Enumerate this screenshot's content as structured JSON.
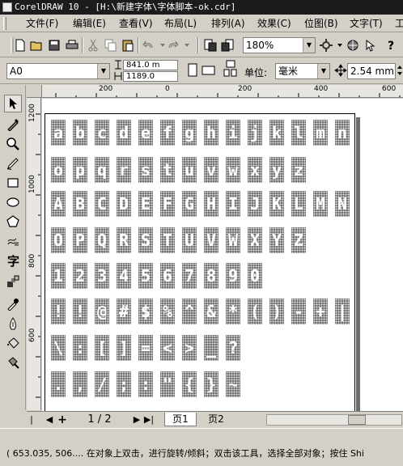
{
  "window": {
    "title": "CorelDRAW 10 - [H:\\新建字体\\字体脚本-ok.cdr]"
  },
  "menu": [
    {
      "label": "文件(F)"
    },
    {
      "label": "编辑(E)"
    },
    {
      "label": "查看(V)"
    },
    {
      "label": "布局(L)"
    },
    {
      "label": "排列(A)"
    },
    {
      "label": "效果(C)"
    },
    {
      "label": "位图(B)"
    },
    {
      "label": "文字(T)"
    },
    {
      "label": "工"
    }
  ],
  "toolbar": {
    "zoom_value": "180%",
    "paper_value": "A0",
    "width_value": "841.0 m",
    "height_value": "1189.0",
    "units_label": "单位:",
    "units_value": "毫米",
    "nudge_value": "2.54 mm"
  },
  "ruler": {
    "h_labels": [
      "200",
      "0",
      "200",
      "400",
      "600"
    ],
    "v_labels": [
      "1200",
      "1000",
      "800",
      "600"
    ]
  },
  "tools": [
    {
      "icon": "pick-tool-icon"
    },
    {
      "icon": "shape-tool-icon"
    },
    {
      "icon": "zoom-tool-icon"
    },
    {
      "icon": "freehand-tool-icon"
    },
    {
      "icon": "rectangle-tool-icon"
    },
    {
      "icon": "ellipse-tool-icon"
    },
    {
      "icon": "polygon-tool-icon"
    },
    {
      "icon": "spiral-tool-icon"
    },
    {
      "icon": "text-tool-icon"
    },
    {
      "icon": "interactive-tool-icon"
    },
    {
      "icon": "eyedropper-tool-icon"
    },
    {
      "icon": "outline-tool-icon"
    },
    {
      "icon": "fill-tool-icon"
    },
    {
      "icon": "interactive-fill-icon"
    }
  ],
  "glyph_rows": [
    [
      "a",
      "b",
      "c",
      "d",
      "e",
      "f",
      "g",
      "h",
      "i",
      "j",
      "k",
      "l",
      "m",
      "n"
    ],
    [
      "o",
      "p",
      "q",
      "r",
      "s",
      "t",
      "u",
      "v",
      "w",
      "x",
      "y",
      "z"
    ],
    [
      "A",
      "B",
      "C",
      "D",
      "E",
      "F",
      "G",
      "H",
      "I",
      "J",
      "K",
      "L",
      "M",
      "N"
    ],
    [
      "O",
      "P",
      "Q",
      "R",
      "S",
      "T",
      "U",
      "V",
      "W",
      "X",
      "Y",
      "Z"
    ],
    [
      "1",
      "2",
      "3",
      "4",
      "5",
      "6",
      "7",
      "8",
      "9",
      "0"
    ],
    [
      "!",
      "!",
      "@",
      "#",
      "$",
      "%",
      "^",
      "&",
      "*",
      "(",
      ")",
      "-",
      "+",
      "|"
    ],
    [
      "\\",
      ":",
      "[",
      "]",
      "=",
      "<",
      ">",
      "_",
      "?"
    ],
    [
      ".",
      ",",
      "/",
      ";",
      ":",
      "\"",
      "{",
      "}",
      "~"
    ]
  ],
  "pagenav": {
    "page_indicator": "1 / 2",
    "tabs": [
      "页1",
      "页2"
    ]
  },
  "status": {
    "text": "( 653.035, 506.... 在对象上双击，进行旋转/倾斜；双击该工具，选择全部对象；按住 Shi"
  }
}
